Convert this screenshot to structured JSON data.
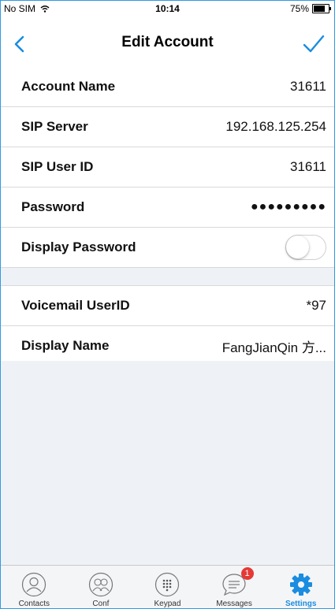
{
  "status_bar": {
    "carrier": "No SIM",
    "time": "10:14",
    "battery": "75%",
    "battery_level": 0.75
  },
  "nav": {
    "title": "Edit Account"
  },
  "fields": [
    {
      "label": "Account Name",
      "value": "31611"
    },
    {
      "label": "SIP Server",
      "value": "192.168.125.254"
    },
    {
      "label": "SIP User ID",
      "value": "31611"
    },
    {
      "label": "Password",
      "value": "●●●●●●●●●"
    },
    {
      "label": "Display Password",
      "toggle_on": false
    }
  ],
  "fields2": [
    {
      "label": "Voicemail UserID",
      "value": "*97"
    },
    {
      "label": "Display Name",
      "value": "FangJianQin 方..."
    }
  ],
  "tabs": [
    {
      "label": "Contacts",
      "icon": "person-icon"
    },
    {
      "label": "Conf",
      "icon": "group-icon"
    },
    {
      "label": "Keypad",
      "icon": "keypad-icon"
    },
    {
      "label": "Messages",
      "icon": "chat-icon",
      "badge": "1"
    },
    {
      "label": "Settings",
      "icon": "gear-icon",
      "active": true
    }
  ],
  "colors": {
    "accent": "#1a8de0",
    "badge": "#e53935",
    "background": "#eef1f5"
  }
}
